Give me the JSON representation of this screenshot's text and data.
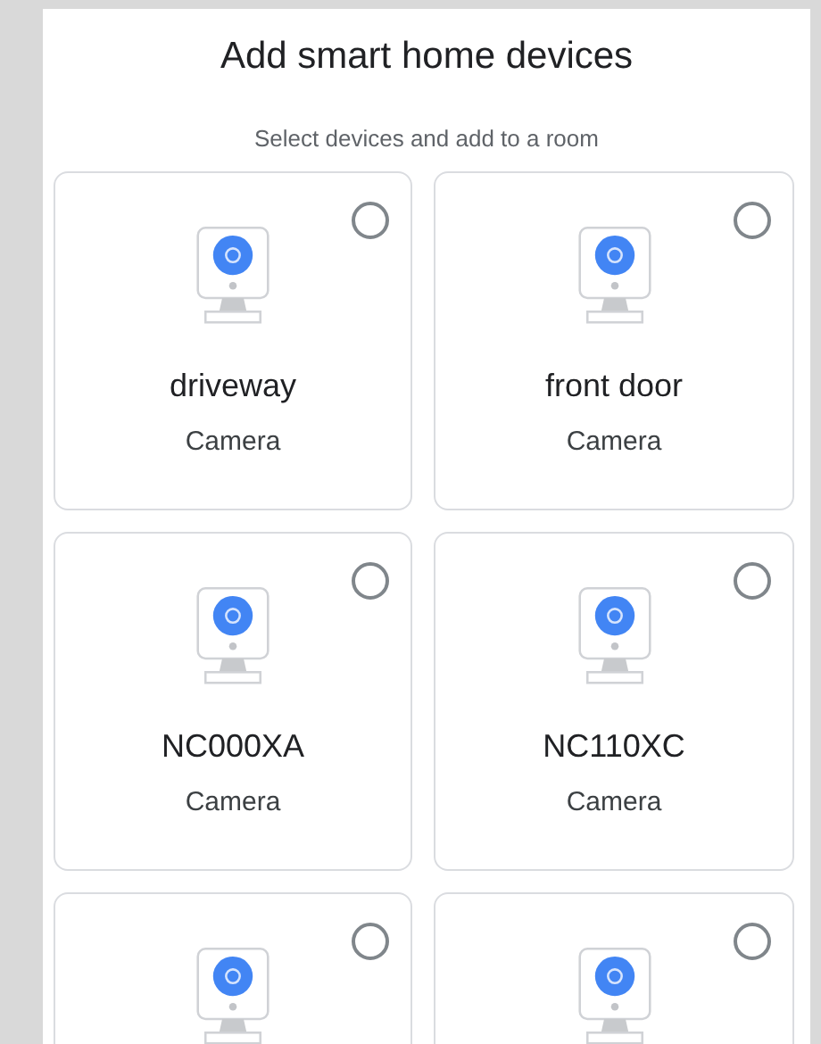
{
  "title": "Add smart home devices",
  "subtitle": "Select devices and add to a room",
  "devices": [
    {
      "name": "driveway",
      "type": "Camera",
      "selected": false
    },
    {
      "name": "front door",
      "type": "Camera",
      "selected": false
    },
    {
      "name": "NC000XA",
      "type": "Camera",
      "selected": false
    },
    {
      "name": "NC110XC",
      "type": "Camera",
      "selected": false
    },
    {
      "selected": false
    },
    {
      "selected": false
    }
  ]
}
